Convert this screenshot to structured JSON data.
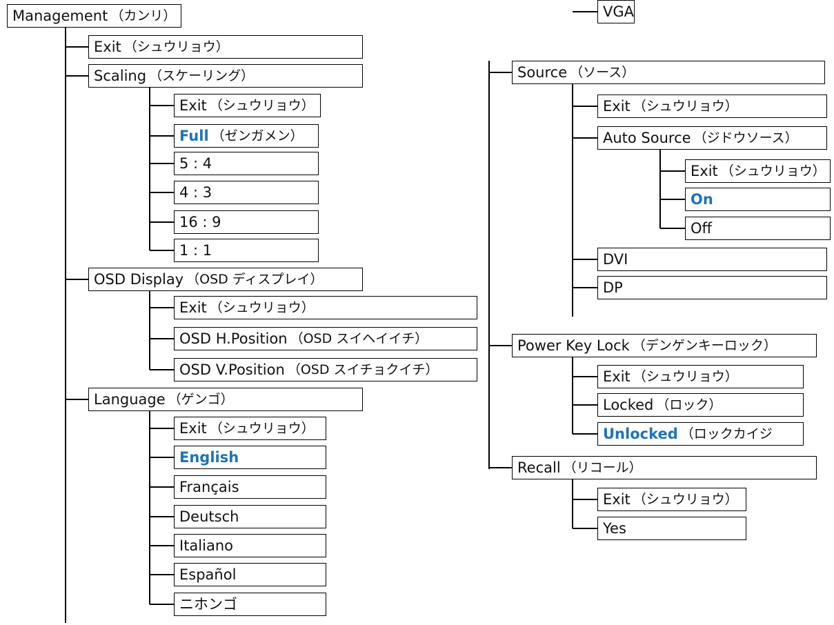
{
  "colors": {
    "highlight": "#1f73b7",
    "line": "#000000",
    "text": "#111111"
  },
  "tree": {
    "root": {
      "label": "Management",
      "kana": "（カンリ）"
    },
    "left": [
      {
        "id": "exit",
        "label": "Exit",
        "kana": "（シュウリョウ）"
      },
      {
        "id": "scaling",
        "label": "Scaling",
        "kana": "（スケーリング）",
        "children": [
          {
            "label": "Exit",
            "kana": "（シュウリョウ）"
          },
          {
            "label": "Full",
            "kana": "（ゼンガメン）",
            "selected": true
          },
          {
            "label": "5 : 4"
          },
          {
            "label": "4 : 3"
          },
          {
            "label": "16 : 9"
          },
          {
            "label": "1 : 1"
          }
        ]
      },
      {
        "id": "osd-display",
        "label": "OSD Display",
        "kana": "（OSD ディスプレイ）",
        "children": [
          {
            "label": "Exit",
            "kana": "（シュウリョウ）"
          },
          {
            "label": "OSD H.Position",
            "kana": "（OSD スイヘイイチ）"
          },
          {
            "label": "OSD V.Position",
            "kana": "（OSD スイチョクイチ）"
          }
        ]
      },
      {
        "id": "language",
        "label": "Language",
        "kana": "（ゲンゴ）",
        "children": [
          {
            "label": "Exit",
            "kana": "（シュウリョウ）"
          },
          {
            "label": "English",
            "selected": true
          },
          {
            "label": "Français"
          },
          {
            "label": "Deutsch"
          },
          {
            "label": "Italiano"
          },
          {
            "label": "Español"
          },
          {
            "label": "ニホンゴ"
          }
        ]
      }
    ],
    "right": [
      {
        "id": "source",
        "label": "Source",
        "kana": "（ソース）",
        "children": [
          {
            "label": "Exit",
            "kana": "（シュウリョウ）"
          },
          {
            "label": "Auto Source",
            "kana": "（ジドウソース）",
            "children": [
              {
                "label": "Exit",
                "kana": "（シュウリョウ）"
              },
              {
                "label": "On",
                "selected": true
              },
              {
                "label": "Off"
              }
            ]
          },
          {
            "label": "VGA"
          },
          {
            "label": "DVI"
          },
          {
            "label": "DP"
          }
        ]
      },
      {
        "id": "power-key-lock",
        "label": "Power Key Lock",
        "kana": "（デンゲンキーロック）",
        "children": [
          {
            "label": "Exit",
            "kana": "（シュウリョウ）"
          },
          {
            "label": "Locked",
            "kana": "（ロック）"
          },
          {
            "label": "Unlocked",
            "kana": "（ロックカイジ",
            "selected": true
          }
        ]
      },
      {
        "id": "recall",
        "label": "Recall",
        "kana": "（リコール）",
        "children": [
          {
            "label": "Exit",
            "kana": "（シュウリョウ）"
          },
          {
            "label": "Yes"
          }
        ]
      }
    ]
  }
}
